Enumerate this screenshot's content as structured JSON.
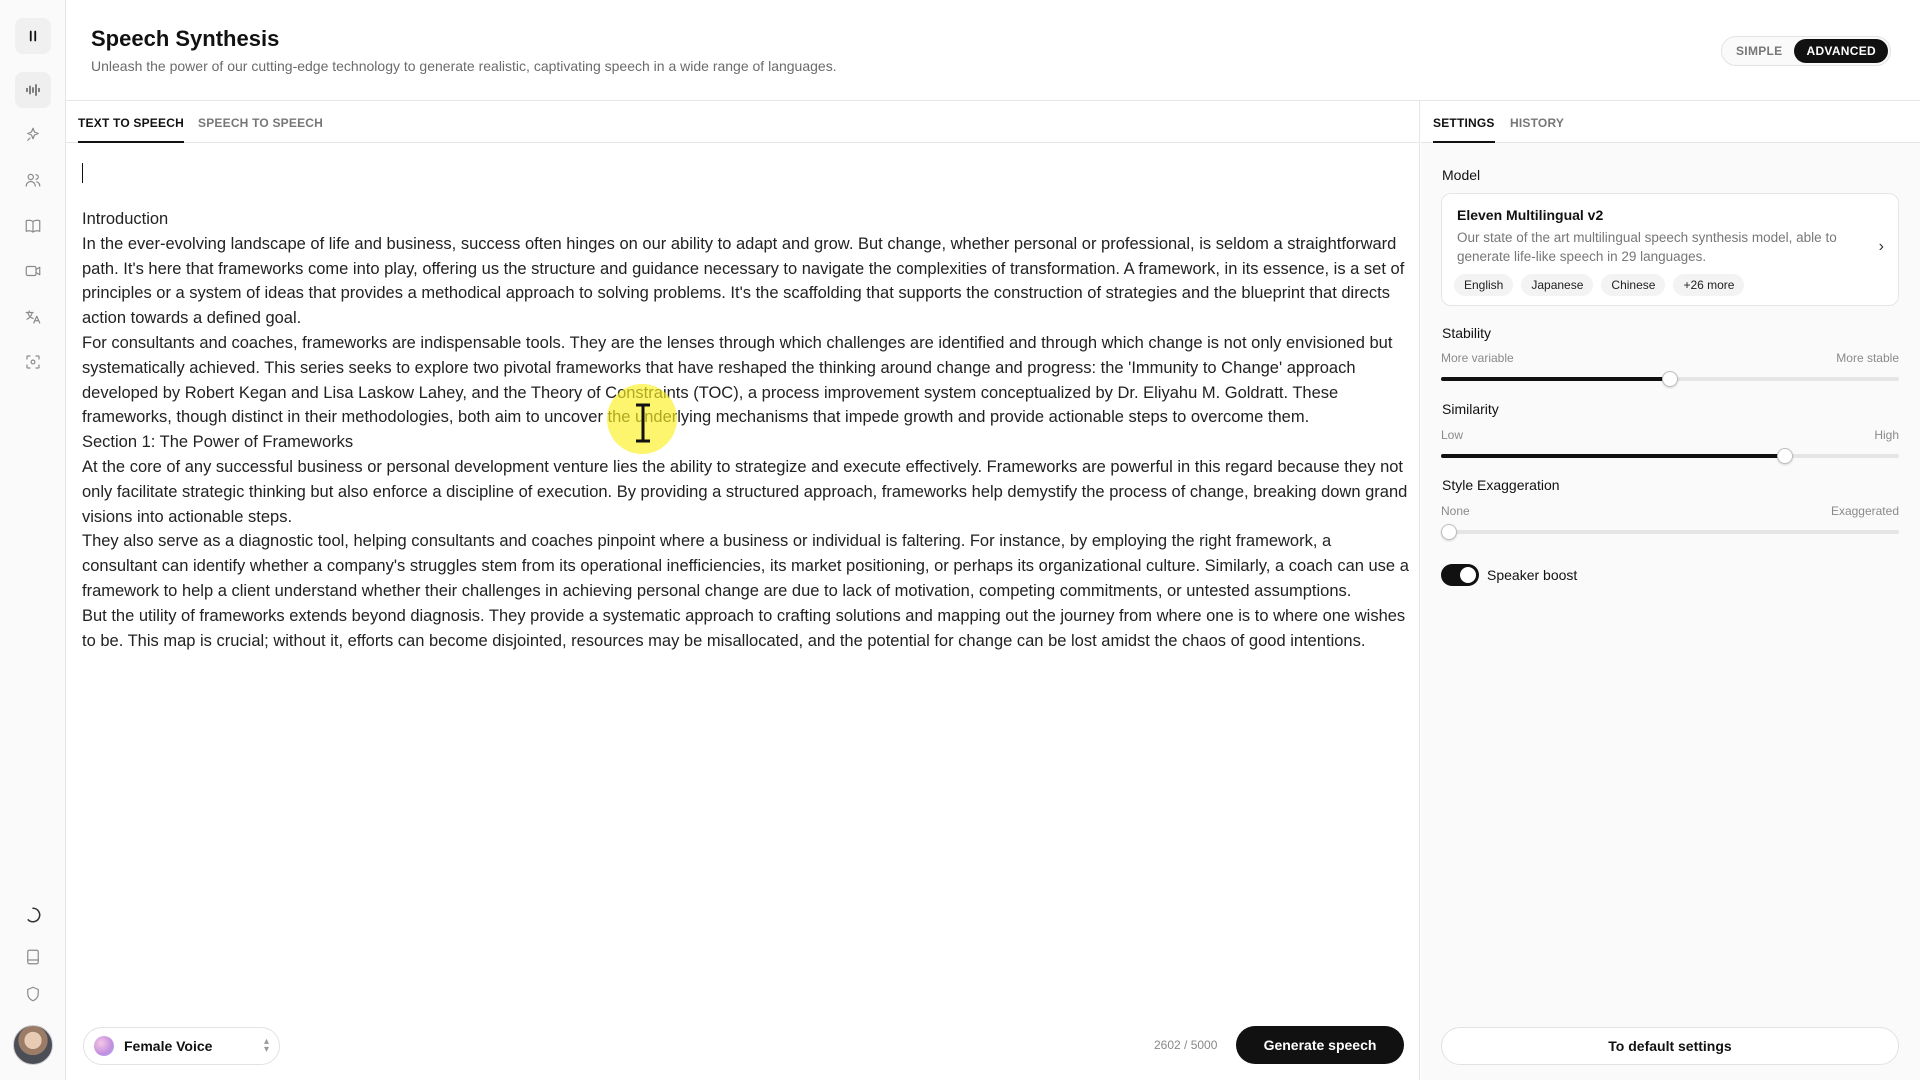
{
  "header": {
    "title": "Speech Synthesis",
    "subtitle": "Unleash the power of our cutting-edge technology to generate realistic, captivating speech in a wide range of languages.",
    "mode_simple": "SIMPLE",
    "mode_advanced": "ADVANCED"
  },
  "main": {
    "tabs": [
      {
        "label": "TEXT TO SPEECH"
      },
      {
        "label": "SPEECH TO SPEECH"
      }
    ],
    "paragraphs": [
      "Introduction",
      "In the ever-evolving landscape of life and business, success often hinges on our ability to adapt and grow. But change, whether personal or professional, is seldom a straightforward path. It's here that frameworks come into play, offering us the structure and guidance necessary to navigate the complexities of transformation. A framework, in its essence, is a set of principles or a system of ideas that provides a methodical approach to solving problems. It's the scaffolding that supports the construction of strategies and the blueprint that directs action towards a defined goal.",
      "For consultants and coaches, frameworks are indispensable tools. They are the lenses through which challenges are identified and through which change is not only envisioned but systematically achieved. This series seeks to explore two pivotal frameworks that have reshaped the thinking around change and progress: the 'Immunity to Change' approach developed by Robert Kegan and Lisa Laskow Lahey, and the Theory of Constraints (TOC), a process improvement system conceptualized by Dr. Eliyahu M. Goldratt. These frameworks, though distinct in their methodologies, both aim to uncover the underlying mechanisms that impede growth and provide actionable steps to overcome them.",
      "Section 1: The Power of Frameworks",
      "At the core of any successful business or personal development venture lies the ability to strategize and execute effectively. Frameworks are powerful in this regard because they not only facilitate strategic thinking but also enforce a discipline of execution. By providing a structured approach, frameworks help demystify the process of change, breaking down grand visions into actionable steps.",
      "They also serve as a diagnostic tool, helping consultants and coaches pinpoint where a business or individual is faltering. For instance, by employing the right framework, a consultant can identify whether a company's struggles stem from its operational inefficiencies, its market positioning, or perhaps its organizational culture. Similarly, a coach can use a framework to help a client understand whether their challenges in achieving personal change are due to lack of motivation, competing commitments, or untested assumptions.",
      "But the utility of frameworks extends beyond diagnosis. They provide a systematic approach to crafting solutions and mapping out the journey from where one is to where one wishes to be. This map is crucial; without it, efforts can become disjointed, resources may be misallocated, and the potential for change can be lost amidst the chaos of good intentions."
    ],
    "voice": "Female Voice",
    "char_count": "2602 / 5000",
    "generate_label": "Generate speech"
  },
  "settings": {
    "tabs": [
      {
        "label": "SETTINGS"
      },
      {
        "label": "HISTORY"
      }
    ],
    "model_label": "Model",
    "model": {
      "name": "Eleven Multilingual v2",
      "description": "Our state of the art multilingual speech synthesis model, able to generate life-like speech in 29 languages.",
      "chips": [
        "English",
        "Japanese",
        "Chinese",
        "+26 more"
      ]
    },
    "stability": {
      "label": "Stability",
      "low": "More variable",
      "high": "More stable",
      "value": 0.5
    },
    "similarity": {
      "label": "Similarity",
      "low": "Low",
      "high": "High",
      "value": 0.75
    },
    "style": {
      "label": "Style Exaggeration",
      "low": "None",
      "high": "Exaggerated",
      "value": 0.0
    },
    "speaker_boost": {
      "label": "Speaker boost",
      "on": true
    },
    "default_label": "To default settings"
  },
  "colors": {
    "accent": "#111111",
    "cursor_highlight": "#faf01e"
  }
}
